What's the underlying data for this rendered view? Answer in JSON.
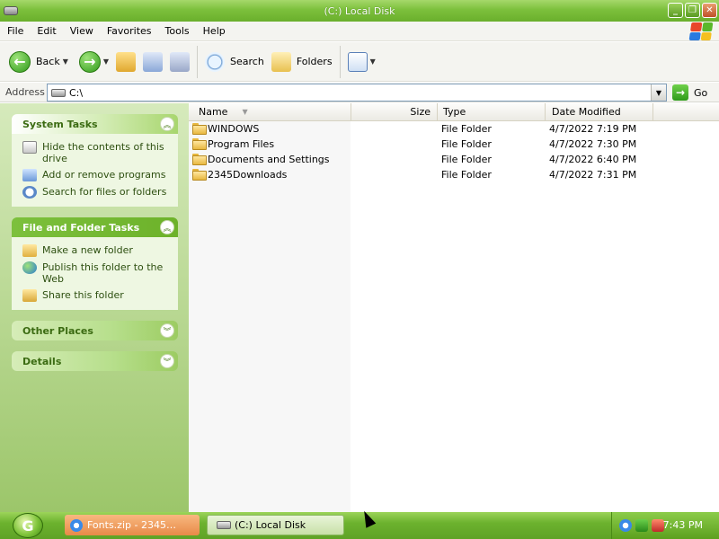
{
  "window": {
    "title": "(C:) Local Disk",
    "minimize_icon": "minimize-icon",
    "maximize_icon": "restore-icon",
    "close_icon": "close-icon"
  },
  "menu": [
    "File",
    "Edit",
    "View",
    "Favorites",
    "Tools",
    "Help"
  ],
  "toolbar": {
    "back_label": "Back",
    "search_label": "Search",
    "folders_label": "Folders"
  },
  "address": {
    "label": "Address",
    "value": "C:\\",
    "go_label": "Go"
  },
  "tasks": {
    "system": {
      "title": "System Tasks",
      "items": [
        "Hide the contents of this drive",
        "Add or remove programs",
        "Search for files or folders"
      ]
    },
    "file_folder": {
      "title": "File and Folder Tasks",
      "items": [
        "Make a new folder",
        "Publish this folder to the Web",
        "Share this folder"
      ]
    },
    "other_places": {
      "title": "Other Places"
    },
    "details": {
      "title": "Details"
    }
  },
  "columns": {
    "name": "Name",
    "size": "Size",
    "type": "Type",
    "date": "Date Modified"
  },
  "files": [
    {
      "name": "WINDOWS",
      "size": "",
      "type": "File Folder",
      "date": "4/7/2022 7:19 PM"
    },
    {
      "name": "Program Files",
      "size": "",
      "type": "File Folder",
      "date": "4/7/2022 7:30 PM"
    },
    {
      "name": "Documents and Settings",
      "size": "",
      "type": "File Folder",
      "date": "4/7/2022 6:40 PM"
    },
    {
      "name": "2345Downloads",
      "size": "",
      "type": "File Folder",
      "date": "4/7/2022 7:31 PM"
    }
  ],
  "taskbar": {
    "items": [
      {
        "label": "Fonts.zip - 2345…"
      },
      {
        "label": "(C:) Local Disk"
      }
    ],
    "clock": "7:43 PM"
  },
  "colors": {
    "theme_green": "#7cc03c",
    "task_link": "#2d4f10"
  }
}
